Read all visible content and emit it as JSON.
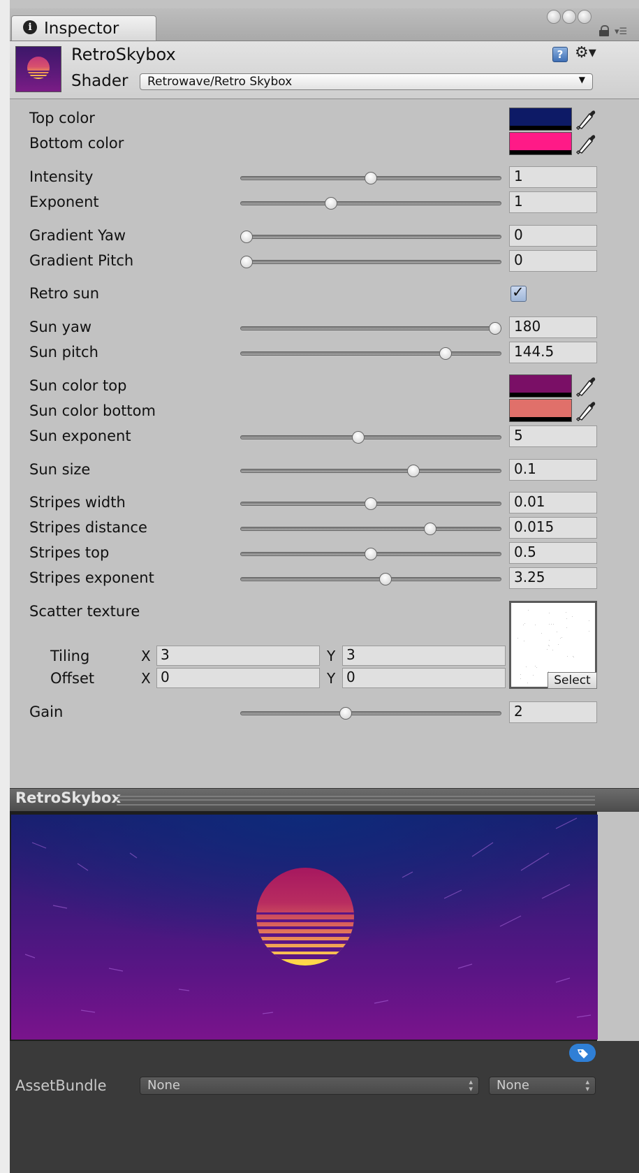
{
  "window": {
    "tab_label": "Inspector"
  },
  "header": {
    "material_name": "RetroSkybox",
    "shader_label": "Shader",
    "shader_value": "Retrowave/Retro Skybox"
  },
  "properties": {
    "top_color": {
      "label": "Top color",
      "color": "#0d1a66"
    },
    "bottom_color": {
      "label": "Bottom color",
      "color": "#ff1a87"
    },
    "intensity": {
      "label": "Intensity",
      "value": "1",
      "slider_fraction": 0.5
    },
    "exponent": {
      "label": "Exponent",
      "value": "1",
      "slider_fraction": 0.34
    },
    "gradient_yaw": {
      "label": "Gradient Yaw",
      "value": "0",
      "slider_fraction": 0.0
    },
    "gradient_pitch": {
      "label": "Gradient Pitch",
      "value": "0",
      "slider_fraction": 0.0
    },
    "retro_sun": {
      "label": "Retro sun",
      "checked": true
    },
    "sun_yaw": {
      "label": "Sun yaw",
      "value": "180",
      "slider_fraction": 1.0
    },
    "sun_pitch": {
      "label": "Sun pitch",
      "value": "144.5",
      "slider_fraction": 0.8
    },
    "sun_color_top": {
      "label": "Sun color top",
      "color": "#7a0f66"
    },
    "sun_color_bottom": {
      "label": "Sun color bottom",
      "color": "#e0706a"
    },
    "sun_exponent": {
      "label": "Sun exponent",
      "value": "5",
      "slider_fraction": 0.45
    },
    "sun_size": {
      "label": "Sun size",
      "value": "0.1",
      "slider_fraction": 0.67
    },
    "stripes_width": {
      "label": "Stripes width",
      "value": "0.01",
      "slider_fraction": 0.5
    },
    "stripes_distance": {
      "label": "Stripes distance",
      "value": "0.015",
      "slider_fraction": 0.74
    },
    "stripes_top": {
      "label": "Stripes top",
      "value": "0.5",
      "slider_fraction": 0.5
    },
    "stripes_exponent": {
      "label": "Stripes exponent",
      "value": "3.25",
      "slider_fraction": 0.56
    },
    "scatter_texture": {
      "label": "Scatter texture",
      "select_label": "Select",
      "tiling_label": "Tiling",
      "offset_label": "Offset",
      "x_label": "X",
      "y_label": "Y",
      "tiling_x": "3",
      "tiling_y": "3",
      "offset_x": "0",
      "offset_y": "0"
    },
    "gain": {
      "label": "Gain",
      "value": "2",
      "slider_fraction": 0.4
    }
  },
  "preview": {
    "title": "RetroSkybox"
  },
  "footer": {
    "assetbundle_label": "AssetBundle",
    "bundle_value": "None",
    "variant_value": "None"
  },
  "icons": [
    "info-icon",
    "lock-icon",
    "menu-icon",
    "help-icon",
    "gear-icon",
    "eyedropper-icon",
    "tag-icon"
  ]
}
